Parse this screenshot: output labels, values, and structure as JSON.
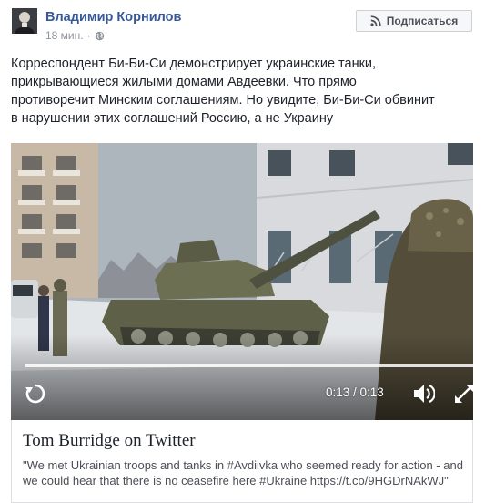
{
  "author": {
    "name": "Владимир Корнилов",
    "time": "18 мин.",
    "privacy_icon": "globe-icon",
    "avatar_icon": "avatar-photo"
  },
  "subscribe_button": {
    "label": "Подписаться",
    "icon": "rss-icon"
  },
  "post": {
    "text": "Корреспондент Би-Би-Си демонстрирует украинские танки,\nприкрывающиеся жилыми домами Авдеевки. Что прямо\nпротиворечит Минским соглашениям. Но увидите, Би-Би-Си обвинит\nв нарушении этих соглашений Россию, а не Украину"
  },
  "video": {
    "timecode": "0:13 / 0:13",
    "progress": 1.0,
    "controls": {
      "replay_icon": "replay-icon",
      "volume_icon": "volume-icon",
      "fullscreen_icon": "fullscreen-icon"
    }
  },
  "link_card": {
    "title": "Tom Burridge on Twitter",
    "description": "\"We met Ukrainian troops and tanks in #Avdiivka who seemed ready for action - and we could hear that there is no ceasefire here #Ukraine https://t.co/9HGDrNAkWJ\""
  },
  "colors": {
    "link_blue": "#365899",
    "meta_gray": "#90949c",
    "border": "#dddfe2"
  }
}
